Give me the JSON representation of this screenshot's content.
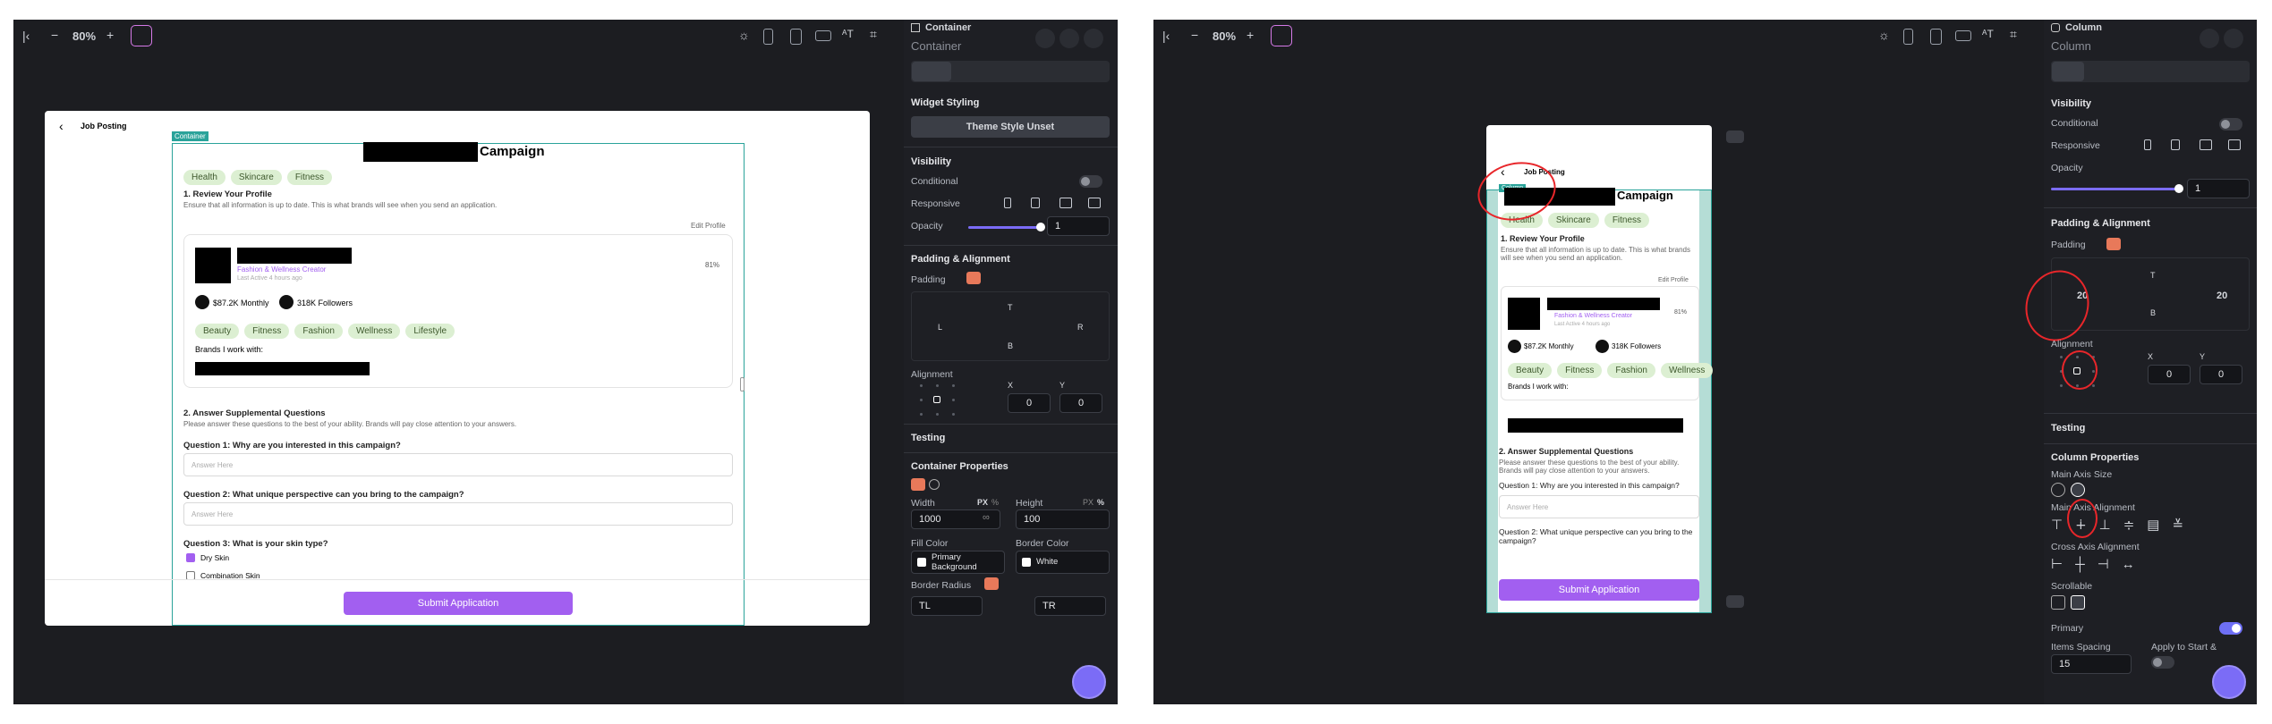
{
  "left": {
    "zoom": "80%",
    "page_header": "Job Posting",
    "container_tag": "Container",
    "campaign_title": "Campaign",
    "tags": [
      "Health",
      "Skincare",
      "Fitness"
    ],
    "section1_title": "1. Review Your Profile",
    "section1_desc": "Ensure that all information is up to date. This is what brands will see when you send an application.",
    "edit_profile": "Edit Profile",
    "creator_role": "Fashion & Wellness Creator",
    "last_active": "Last Active 4 hours ago",
    "score": "81%",
    "monthly": "$87.2K Monthly",
    "followers": "318K Followers",
    "profile_tags": [
      "Beauty",
      "Fitness",
      "Fashion",
      "Wellness",
      "Lifestyle"
    ],
    "brands_label": "Brands I work with:",
    "section2_title": "2. Answer Supplemental Questions",
    "section2_desc": "Please answer these questions to the best of your ability. Brands will pay close attention to your answers.",
    "q1": "Question 1: Why are you interested in this campaign?",
    "q2": "Question 2: What unique perspective can you bring to the campaign?",
    "q3": "Question 3: What is your skin type?",
    "answer_placeholder": "Answer Here",
    "opt1": "Dry Skin",
    "opt2": "Combination Skin",
    "submit": "Submit Application"
  },
  "left_props": {
    "title": "Container",
    "subtitle": "Container",
    "widget_styling": "Widget Styling",
    "theme_btn": "Theme Style Unset",
    "visibility": "Visibility",
    "conditional": "Conditional",
    "responsive": "Responsive",
    "opacity": "Opacity",
    "opacity_val": "1",
    "padding_align": "Padding & Alignment",
    "padding": "Padding",
    "pad_t": "T",
    "pad_b": "B",
    "pad_l": "L",
    "pad_r": "R",
    "alignment": "Alignment",
    "x_label": "X",
    "y_label": "Y",
    "x_val": "0",
    "y_val": "0",
    "testing": "Testing",
    "container_props": "Container Properties",
    "width": "Width",
    "height": "Height",
    "px": "PX",
    "pct": "%",
    "width_val": "1000",
    "height_val": "100",
    "infinity": "∞",
    "fill_color": "Fill Color",
    "border_color": "Border Color",
    "fill_val": "Primary Background",
    "border_val": "White",
    "border_radius": "Border Radius",
    "tl": "TL",
    "tr": "TR"
  },
  "right": {
    "zoom": "80%",
    "page_header": "Job Posting",
    "container_tag": "Column",
    "campaign_title": "Campaign",
    "tags": [
      "Health",
      "Skincare",
      "Fitness"
    ],
    "section1_title": "1. Review Your Profile",
    "section1_desc": "Ensure that all information is up to date. This is what brands will see when you send an application.",
    "edit_profile": "Edit Profile",
    "creator_role": "Fashion & Wellness Creator",
    "last_active": "Last Active 4 hours ago",
    "score": "81%",
    "monthly": "$87.2K Monthly",
    "followers": "318K Followers",
    "profile_tags": [
      "Beauty",
      "Fitness",
      "Fashion",
      "Wellness"
    ],
    "brands_label": "Brands I work with:",
    "section2_title": "2. Answer Supplemental Questions",
    "section2_desc": "Please answer these questions to the best of your ability. Brands will pay close attention to your answers.",
    "q1": "Question 1: Why are you interested in this campaign?",
    "q2": "Question 2: What unique perspective can you bring to the campaign?",
    "answer_placeholder": "Answer Here",
    "submit": "Submit Application"
  },
  "right_props": {
    "title": "Column",
    "subtitle": "Column",
    "visibility": "Visibility",
    "conditional": "Conditional",
    "responsive": "Responsive",
    "opacity": "Opacity",
    "opacity_val": "1",
    "padding_align": "Padding & Alignment",
    "padding": "Padding",
    "pad_t": "T",
    "pad_b": "B",
    "pad_l_val": "20",
    "pad_r_val": "20",
    "alignment": "Alignment",
    "x_label": "X",
    "y_label": "Y",
    "x_val": "0",
    "y_val": "0",
    "testing": "Testing",
    "column_props": "Column Properties",
    "main_axis_size": "Main Axis Size",
    "main_axis_align": "Main Axis Alignment",
    "cross_axis_align": "Cross Axis Alignment",
    "scrollable": "Scrollable",
    "primary": "Primary",
    "items_spacing": "Items Spacing",
    "apply_start": "Apply to Start &",
    "spacing_val": "15"
  },
  "colors": {
    "accent": "#e8795a",
    "purple": "#a25ff0",
    "teal": "#2aa39a",
    "annotation": "#e8262a"
  }
}
